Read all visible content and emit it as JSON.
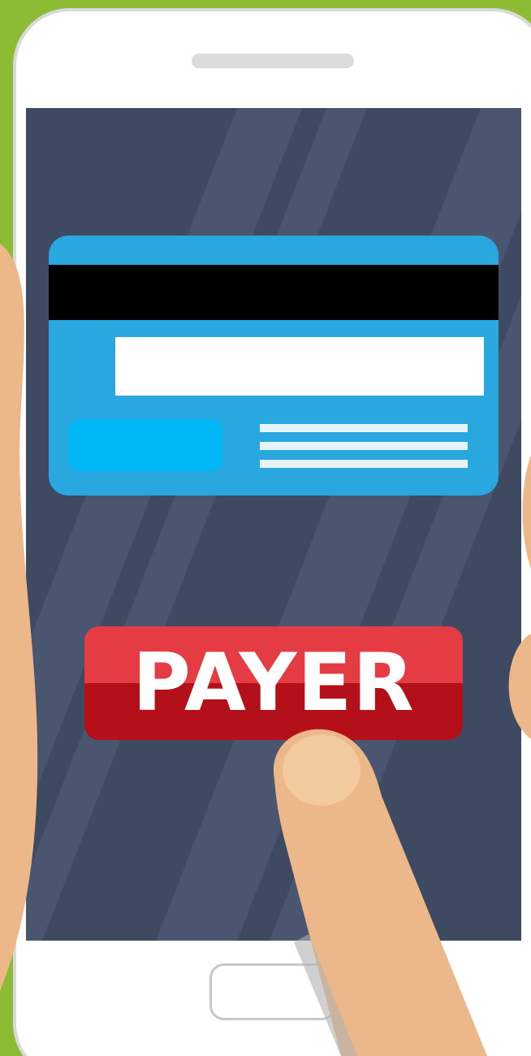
{
  "screen": {
    "pay_button_label": "PAYER"
  },
  "colors": {
    "background": "#8dbb34",
    "phone_body": "#ffffff",
    "screen": "#3e4a62",
    "card": "#29a8e0",
    "card_stripe": "#000000",
    "pay_button_top": "#e53c44",
    "pay_button_bottom": "#b3101a",
    "skin": "#ecb88a"
  }
}
